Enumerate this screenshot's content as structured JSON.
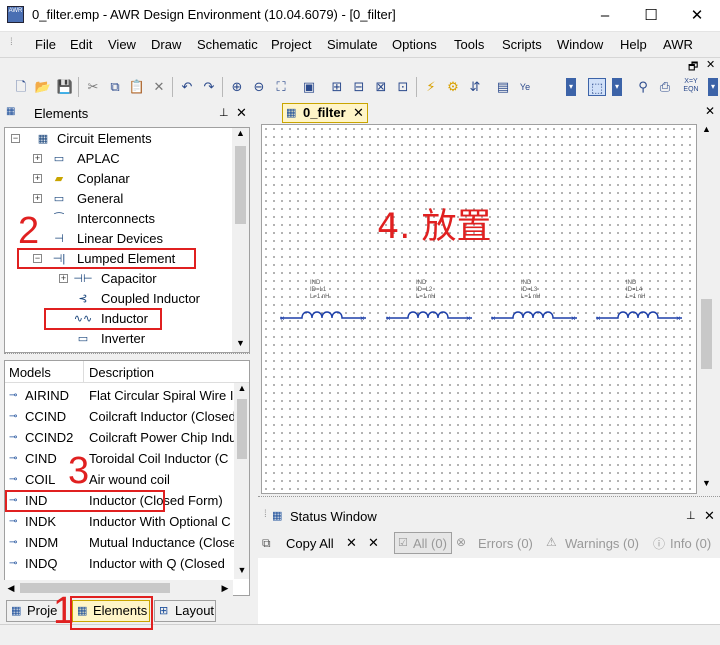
{
  "window": {
    "title": "0_filter.emp - AWR Design Environment (10.04.6079) - [0_filter]",
    "minimize": "–",
    "maximize": "☐",
    "close": "✕",
    "app_icon_text": "AWR"
  },
  "menu": [
    "File",
    "Edit",
    "View",
    "Draw",
    "Schematic",
    "Project",
    "Simulate",
    "Options",
    "Tools",
    "Scripts",
    "Window",
    "Help",
    "AWR"
  ],
  "mdi_controls": {
    "restore": "🗗",
    "close": "✕",
    "pin": "ꟷ"
  },
  "elements_pane": {
    "title": "Elements",
    "pin": "ꟷ",
    "close": "✕"
  },
  "tree": {
    "root": "Circuit Elements",
    "items": [
      {
        "label": "APLAC",
        "expander": "+",
        "icon": "▭"
      },
      {
        "label": "Coplanar",
        "expander": "+",
        "icon": "▰"
      },
      {
        "label": "General",
        "expander": "+",
        "icon": "▭"
      },
      {
        "label": "Interconnects",
        "expander": "",
        "icon": "⁀"
      },
      {
        "label": "Linear Devices",
        "expander": "",
        "icon": "⊣"
      },
      {
        "label": "Lumped Element",
        "expander": "−",
        "icon": "⊣|"
      },
      {
        "label": "Capacitor",
        "expander": "+",
        "icon": "⊣⊢"
      },
      {
        "label": "Coupled Inductor",
        "expander": "",
        "icon": "⊰"
      },
      {
        "label": "Inductor",
        "expander": "",
        "icon": "∿∿"
      },
      {
        "label": "Inverter",
        "expander": "",
        "icon": "▭"
      }
    ]
  },
  "models": {
    "headers": {
      "model": "Models",
      "description": "Description"
    },
    "rows": [
      {
        "model": "AIRIND",
        "description": "Flat Circular Spiral Wire I"
      },
      {
        "model": "CCIND",
        "description": "Coilcraft Inductor (Closed"
      },
      {
        "model": "CCIND2",
        "description": "Coilcraft Power Chip Indu"
      },
      {
        "model": "CIND",
        "description": "Toroidal Coil Inductor (C"
      },
      {
        "model": "COIL",
        "description": "Air wound coil"
      },
      {
        "model": "IND",
        "description": "Inductor (Closed Form)"
      },
      {
        "model": "INDK",
        "description": "Inductor With Optional C"
      },
      {
        "model": "INDM",
        "description": "Mutual Inductance (Close"
      },
      {
        "model": "INDQ",
        "description": "Inductor with Q (Closed"
      }
    ]
  },
  "bottom_tabs": [
    "Proje",
    "Elements",
    "Layout"
  ],
  "doc_tab": {
    "label": "0_filter",
    "close": "✕"
  },
  "schematic": {
    "annotation": "4. 放置",
    "inductors": [
      {
        "type": "IND",
        "id": "ID=L1",
        "value": "L=1 nH"
      },
      {
        "type": "IND",
        "id": "ID=L2",
        "value": "L=1 nH"
      },
      {
        "type": "IND",
        "id": "ID=L3",
        "value": "L=1 nH"
      },
      {
        "type": "IND",
        "id": "ID=L4",
        "value": "L=1 nH"
      }
    ]
  },
  "status_window": {
    "title": "Status Window",
    "copy_all": "Copy All",
    "all": "All (0)",
    "errors": "Errors (0)",
    "warnings": "Warnings (0)",
    "info": "Info (0)"
  },
  "callouts": {
    "one": "1",
    "two": "2",
    "three": "3"
  },
  "colors": {
    "callout": "#e02020",
    "doc_tab": "#fff5c8",
    "inductor": "#1d3fa8"
  }
}
